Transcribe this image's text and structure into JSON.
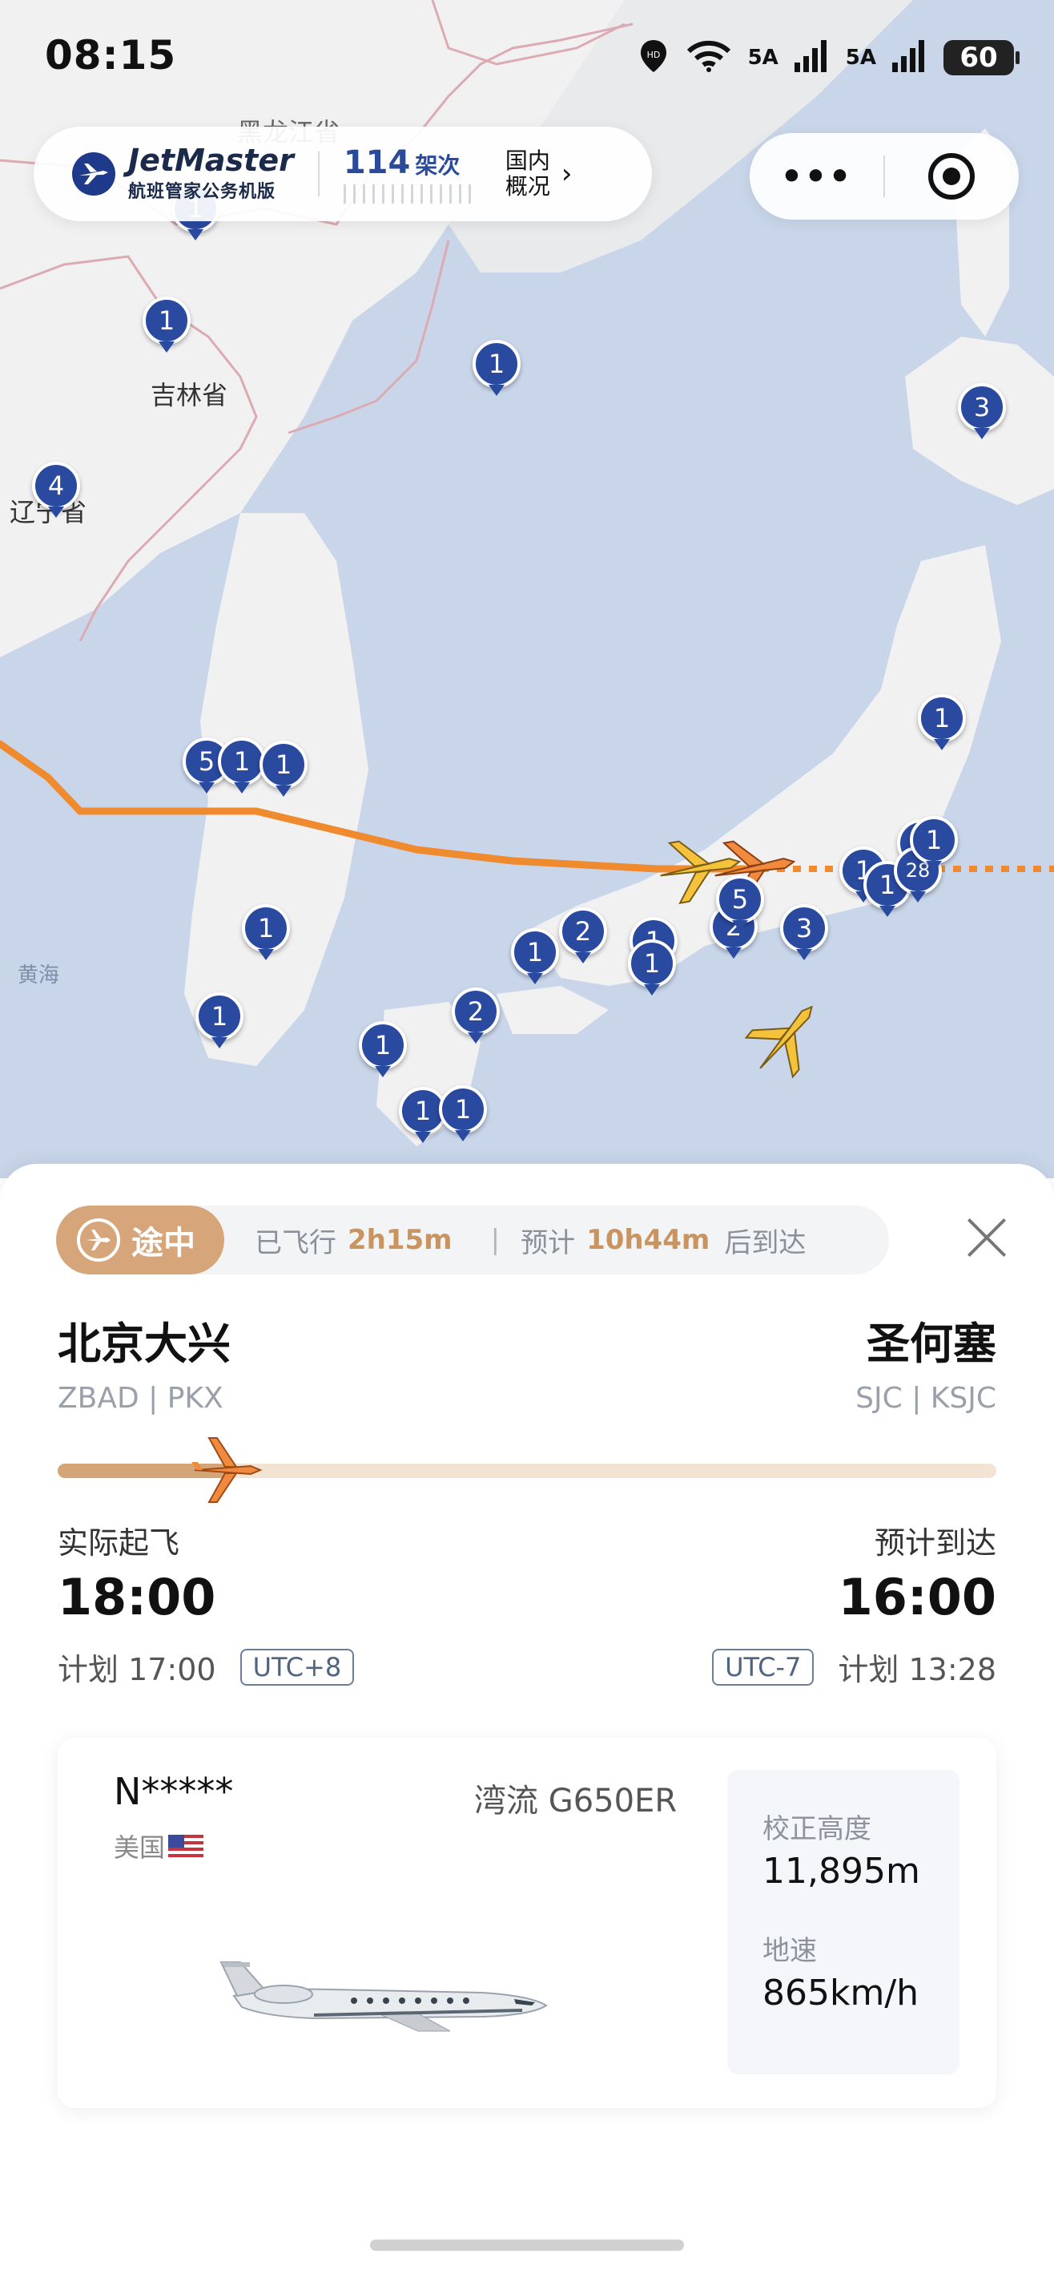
{
  "status_bar": {
    "time": "08:15",
    "signal_1": "5A",
    "signal_2": "5A",
    "battery": "60"
  },
  "brand": {
    "name": "JetMaster",
    "subtitle": "航班管家公务机版",
    "count_number": "114",
    "count_unit": "架次",
    "domestic_line1": "国内",
    "domestic_line2": "概况"
  },
  "capsule": {
    "more": "•••"
  },
  "map": {
    "labels": [
      "黑龙江省",
      "吉林省",
      "辽宁省",
      "黄海"
    ],
    "clusters": [
      "1",
      "1",
      "1",
      "4",
      "3",
      "5",
      "1",
      "1",
      "1",
      "1",
      "1",
      "1",
      "1",
      "1",
      "2",
      "2",
      "1",
      "2",
      "5",
      "3",
      "1",
      "1",
      "1",
      "1",
      "1",
      "28",
      "1"
    ]
  },
  "flight": {
    "status": "途中",
    "flown_label": "已飞行",
    "flown_value": "2h15m",
    "separator": "|",
    "eta_label": "预计",
    "eta_value": "10h44m",
    "eta_suffix": "后到达",
    "origin_city": "北京大兴",
    "origin_code": "ZBAD | PKX",
    "dest_city": "圣何塞",
    "dest_code": "SJC | KSJC",
    "progress": 0.18,
    "dep_label": "实际起飞",
    "dep_time": "18:00",
    "dep_plan": "计划 17:00",
    "dep_tz": "UTC+8",
    "arr_label": "预计到达",
    "arr_time": "16:00",
    "arr_plan": "计划 13:28",
    "arr_tz": "UTC-7"
  },
  "aircraft": {
    "registration": "N*****",
    "country": "美国",
    "model": "湾流 G650ER",
    "altitude_label": "校正高度",
    "altitude_value": "11,895m",
    "speed_label": "地速",
    "speed_value": "865km/h"
  },
  "colors": {
    "accent": "#d6a57a",
    "route": "#ef8a2e",
    "pin": "#2a4aa0",
    "sea": "#c9d6ea",
    "land": "#f1f1f2"
  }
}
